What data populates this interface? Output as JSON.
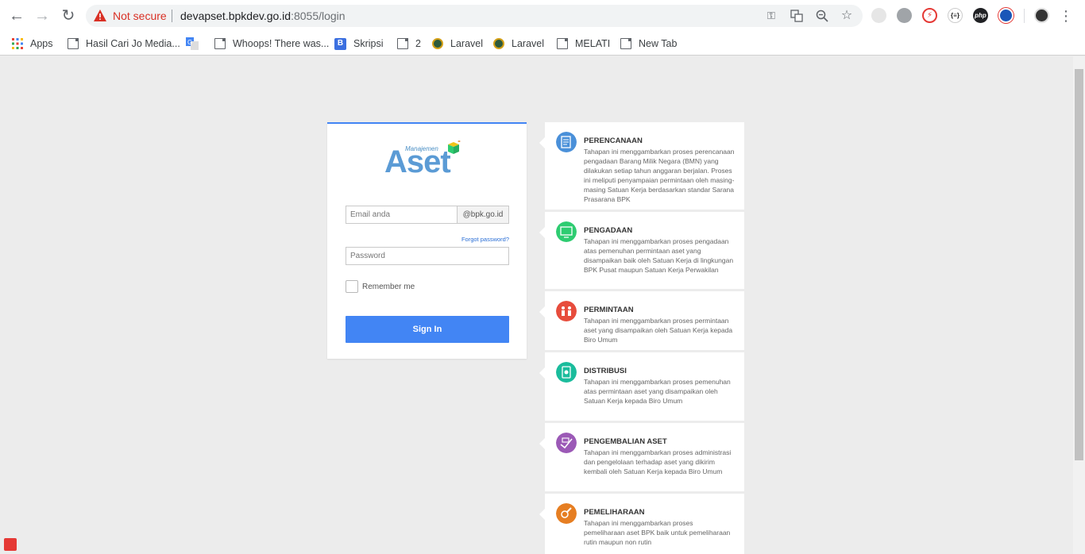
{
  "browser": {
    "security_label": "Not secure",
    "url_host": "devapset.bpkdev.go.id",
    "url_rest": ":8055/login",
    "extensions": [
      {
        "name": "extension-puzzle-icon",
        "color": "#e8e8e8"
      },
      {
        "name": "globe-icon",
        "color": "#9aa0a6"
      },
      {
        "name": "lightning-icon",
        "color": "#e53935"
      },
      {
        "name": "json-viewer-icon",
        "color": "#ffffff",
        "label": "{≡}"
      },
      {
        "name": "php-icon",
        "color": "#202124",
        "label": "php"
      },
      {
        "name": "globe-blue-icon",
        "color": "#1a56b8"
      }
    ]
  },
  "bookmarks": [
    {
      "label": "Apps",
      "icon": "apps-grid-icon"
    },
    {
      "label": "Hasil Cari Jo Media...",
      "icon": "page-icon"
    },
    {
      "label": "",
      "icon": "translate-icon"
    },
    {
      "label": "Whoops! There was...",
      "icon": "page-icon"
    },
    {
      "label": "Skripsi",
      "icon": "blogger-icon"
    },
    {
      "label": "2",
      "icon": "page-icon"
    },
    {
      "label": "Laravel",
      "icon": "site-globe-icon"
    },
    {
      "label": "Laravel",
      "icon": "site-globe-icon"
    },
    {
      "label": "MELATI",
      "icon": "page-icon"
    },
    {
      "label": "New Tab",
      "icon": "page-icon"
    }
  ],
  "login": {
    "logo_sub": "Manajemen",
    "logo_main": "Aset",
    "email_placeholder": "Email anda",
    "email_suffix": "@bpk.go.id",
    "forgot_label": "Forgot password?",
    "password_placeholder": "Password",
    "remember_label": "Remember me",
    "signin_label": "Sign In"
  },
  "steps": [
    {
      "title": "PERENCANAAN",
      "icon": "planning-icon",
      "color": "#4a90d9",
      "desc": "Tahapan ini menggambarkan proses perencanaan pengadaan Barang Milik Negara (BMN) yang dilakukan setiap tahun anggaran berjalan. Proses ini meliputi penyampaian permintaan oleh masing-masing Satuan Kerja berdasarkan standar Sarana Prasarana BPK"
    },
    {
      "title": "PENGADAAN",
      "icon": "procurement-icon",
      "color": "#2ecc71",
      "desc": "Tahapan ini menggambarkan proses pengadaan atas pemenuhan permintaan aset yang disampaikan baik oleh Satuan Kerja di lingkungan BPK Pusat maupun Satuan Kerja Perwakilan"
    },
    {
      "title": "PERMINTAAN",
      "icon": "request-icon",
      "color": "#e74c3c",
      "desc": "Tahapan ini menggambarkan proses permintaan aset yang disampaikan oleh Satuan Kerja kepada Biro Umum"
    },
    {
      "title": "DISTRIBUSI",
      "icon": "distribution-icon",
      "color": "#1abc9c",
      "desc": "Tahapan ini menggambarkan proses pemenuhan atas permintaan aset yang disampaikan oleh Satuan Kerja kepada Biro Umum"
    },
    {
      "title": "PENGEMBALIAN ASET",
      "icon": "return-asset-icon",
      "color": "#9b59b6",
      "desc": "Tahapan ini menggambarkan proses administrasi dan pengelolaan terhadap aset yang dikirim kembali oleh Satuan Kerja kepada Biro Umum"
    },
    {
      "title": "PEMELIHARAAN",
      "icon": "maintenance-icon",
      "color": "#e67e22",
      "desc": "Tahapan ini menggambarkan proses pemeliharaan aset BPK baik untuk pemeliharaan rutin maupun non rutin"
    }
  ]
}
